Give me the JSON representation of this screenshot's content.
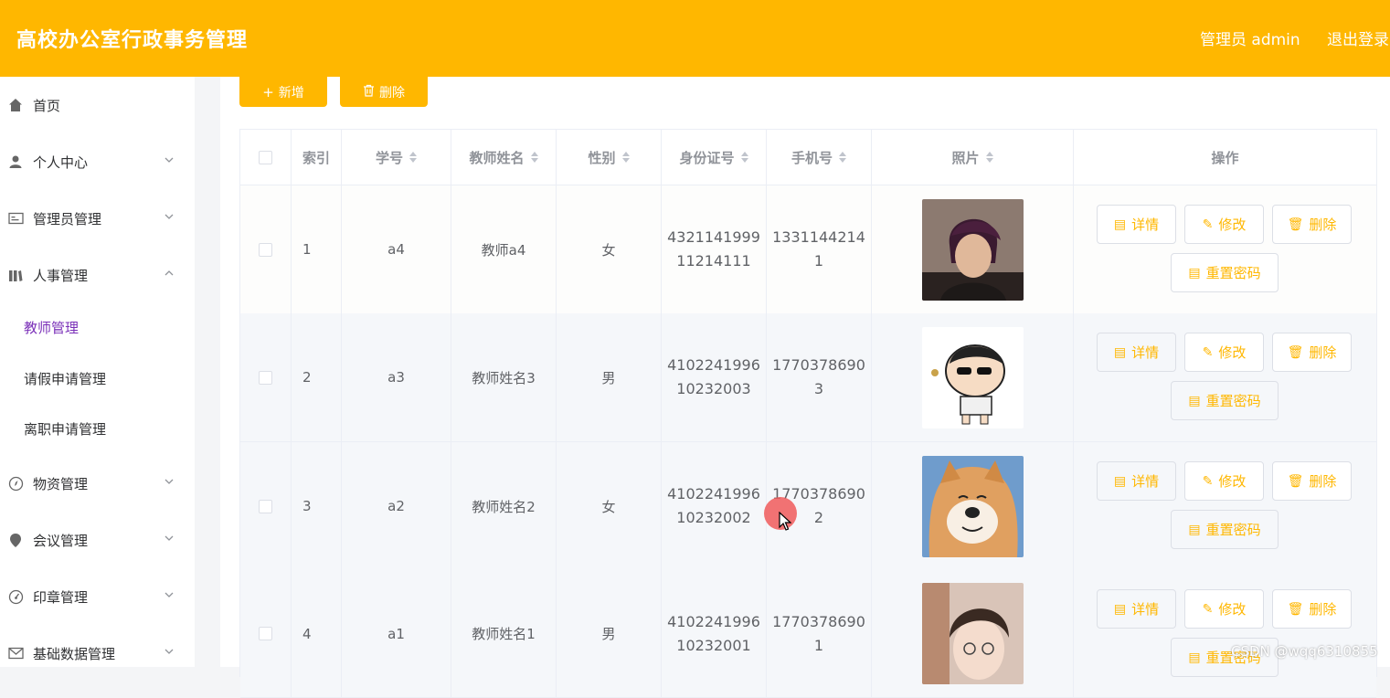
{
  "header": {
    "title": "高校办公室行政事务管理",
    "user": "管理员 admin",
    "logout": "退出登录"
  },
  "sidebar": {
    "items": [
      {
        "label": "首页",
        "icon": "home-icon"
      },
      {
        "label": "个人中心",
        "icon": "user-icon"
      },
      {
        "label": "管理员管理",
        "icon": "id-card-icon"
      },
      {
        "label": "人事管理",
        "icon": "library-icon",
        "expanded": true,
        "children": [
          "教师管理",
          "请假申请管理",
          "离职申请管理"
        ]
      },
      {
        "label": "物资管理",
        "icon": "compass-icon"
      },
      {
        "label": "会议管理",
        "icon": "location-icon"
      },
      {
        "label": "印章管理",
        "icon": "gauge-icon"
      },
      {
        "label": "基础数据管理",
        "icon": "mail-icon"
      }
    ],
    "active": "教师管理"
  },
  "toolbar": {
    "add_label": "新增",
    "delete_label": "删除"
  },
  "table": {
    "columns": [
      "索引",
      "学号",
      "教师姓名",
      "性别",
      "身份证号",
      "手机号",
      "照片",
      "操作"
    ],
    "rows": [
      {
        "index": "1",
        "id": "a4",
        "name": "教师a4",
        "gender": "女",
        "idcard_1": "4321141999",
        "idcard_2": "11214111",
        "phone_1": "1331144214",
        "phone_2": "1",
        "photo": "portrait-young-man"
      },
      {
        "index": "2",
        "id": "a3",
        "name": "教师姓名3",
        "gender": "男",
        "idcard_1": "4102241996",
        "idcard_2": "10232003",
        "phone_1": "1770378690",
        "phone_2": "3",
        "photo": "cartoon-boy"
      },
      {
        "index": "3",
        "id": "a2",
        "name": "教师姓名2",
        "gender": "女",
        "idcard_1": "4102241996",
        "idcard_2": "10232002",
        "phone_1": "1770378690",
        "phone_2": "2",
        "photo": "shiba-dog"
      },
      {
        "index": "4",
        "id": "a1",
        "name": "教师姓名1",
        "gender": "男",
        "idcard_1": "4102241996",
        "idcard_2": "10232001",
        "phone_1": "1770378690",
        "phone_2": "1",
        "photo": "girl-selfie"
      }
    ],
    "actions": {
      "detail": "详情",
      "edit": "修改",
      "delete": "删除",
      "reset": "重置密码"
    }
  },
  "watermark": "CSDN @wqq6310855",
  "colors": {
    "accent": "#ffb700",
    "active_menu": "#7a2fb8",
    "border": "#ebeef5"
  }
}
